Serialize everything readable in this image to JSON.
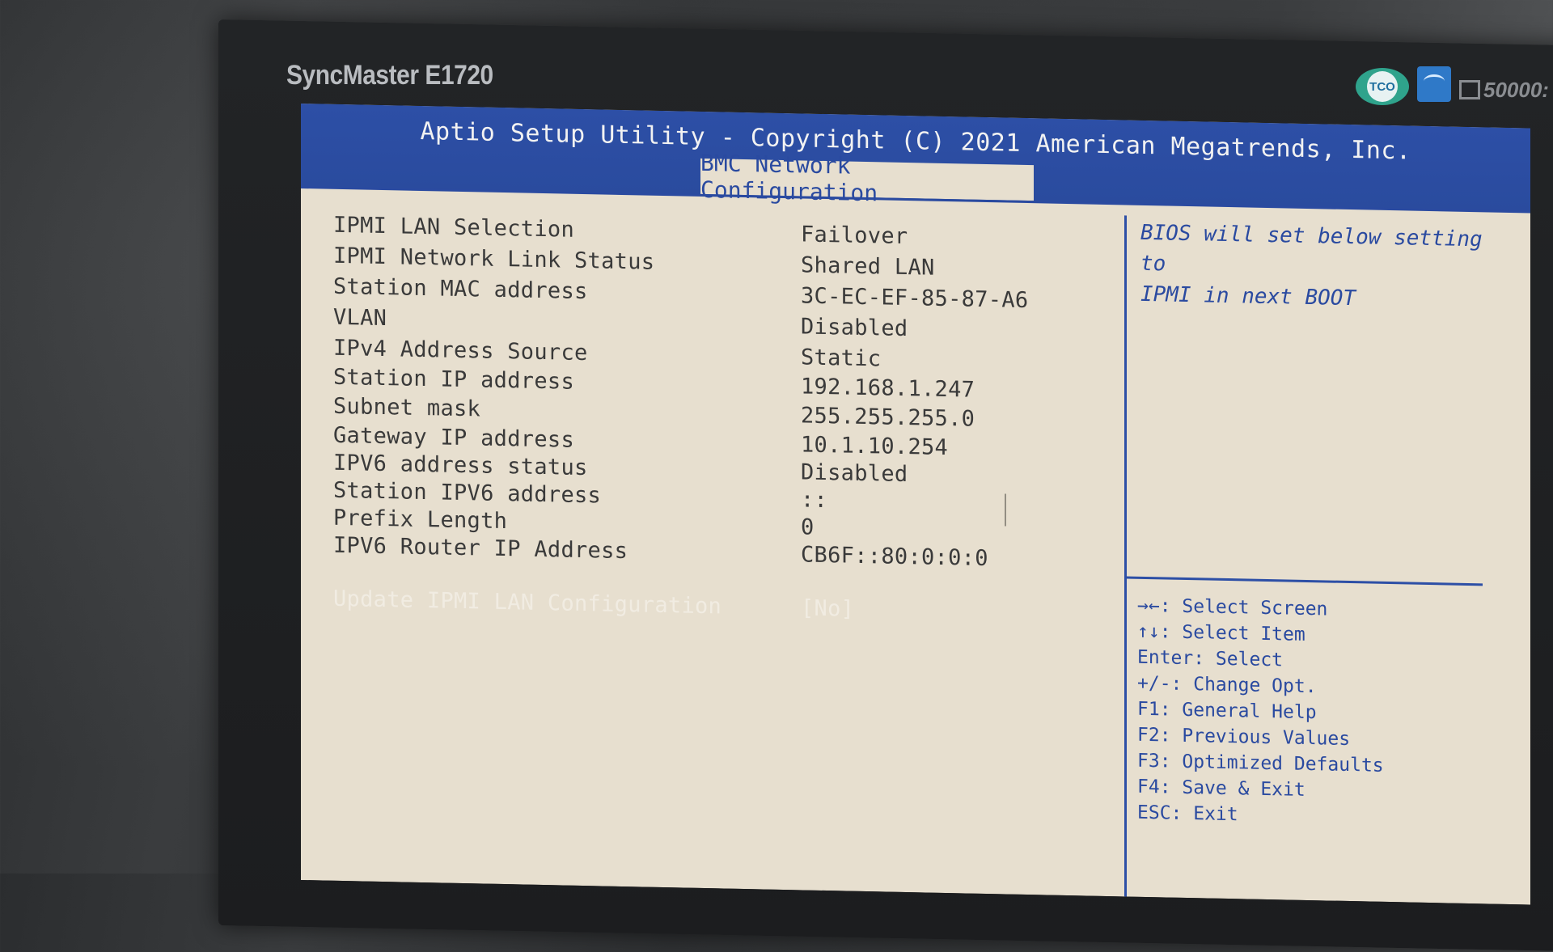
{
  "monitor": {
    "brand": "SyncMaster E1720",
    "badges": {
      "tco_label": "TCO",
      "ratio_label": "50000:"
    }
  },
  "bios": {
    "title": "Aptio Setup Utility - Copyright (C) 2021 American Megatrends, Inc.",
    "tab": "BMC Network Configuration",
    "settings": [
      {
        "label": "IPMI LAN Selection",
        "value": "Failover"
      },
      {
        "label": "IPMI Network Link Status",
        "value": "Shared LAN"
      },
      {
        "label": "Station MAC address",
        "value": "3C-EC-EF-85-87-A6"
      },
      {
        "label": "VLAN",
        "value": "Disabled"
      },
      {
        "label": "IPv4 Address Source",
        "value": "Static"
      },
      {
        "label": "Station IP address",
        "value": "192.168.1.247"
      },
      {
        "label": "Subnet mask",
        "value": "255.255.255.0"
      },
      {
        "label": "Gateway IP address",
        "value": "10.1.10.254"
      },
      {
        "label": "IPV6 address status",
        "value": "Disabled"
      },
      {
        "label": "Station IPV6 address",
        "value": "::"
      },
      {
        "label": "Prefix Length",
        "value": "0"
      },
      {
        "label": "IPV6 Router IP Address",
        "value": "CB6F::80:0:0:0"
      }
    ],
    "action": {
      "label": "Update IPMI LAN Configuration",
      "value": "[No]"
    },
    "help_text": [
      "BIOS will set below setting to",
      "IPMI in next BOOT"
    ],
    "key_help": [
      "→←: Select Screen",
      "↑↓: Select Item",
      "Enter: Select",
      "+/-: Change Opt.",
      "F1: General Help",
      "F2: Previous Values",
      "F3: Optimized Defaults",
      "F4: Save & Exit",
      "ESC: Exit"
    ]
  }
}
